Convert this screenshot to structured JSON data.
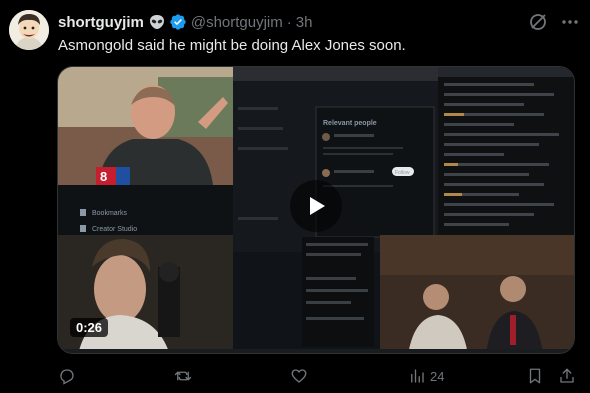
{
  "post": {
    "display_name": "shortguyjim",
    "handle": "@shortguyjim",
    "separator": "·",
    "timestamp": "3h",
    "text": "Asmongold said he might be doing Alex Jones soon.",
    "badge_icon": "alien-icon",
    "verified_icon": "verified-badge-icon",
    "verified_color": "#1d9bf0"
  },
  "media": {
    "duration": "0:26",
    "play_icon": "play-icon",
    "screen": {
      "nav_items": [
        "Bookmarks",
        "Creator Studio"
      ],
      "relevant_people_title": "Relevant people",
      "follow_label": "Follow",
      "trending_item": "Republicans And Democrats UNITE To Push For M..."
    }
  },
  "actions": {
    "reply_icon": "reply-icon",
    "repost_icon": "repost-icon",
    "like_icon": "heart-icon",
    "views_icon": "views-chart-icon",
    "views_count": "24",
    "bookmark_icon": "bookmark-icon",
    "share_icon": "share-icon"
  },
  "colors": {
    "background": "#000000",
    "text_primary": "#e7e9ea",
    "text_secondary": "#71767b",
    "accent": "#1d9bf0"
  }
}
